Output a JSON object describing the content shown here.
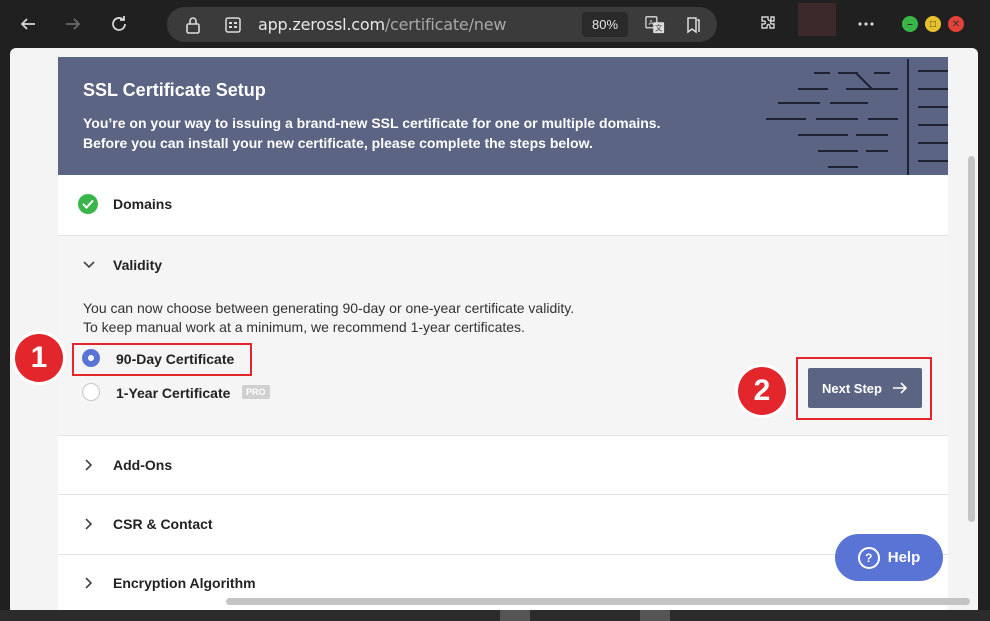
{
  "browser": {
    "url_host": "app.zerossl.com",
    "url_path": "/certificate/new",
    "zoom": "80%"
  },
  "hero": {
    "title": "SSL Certificate Setup",
    "desc_line1": "You’re on your way to issuing a brand-new SSL certificate for one or multiple domains.",
    "desc_line2": "Before you can install your new certificate, please complete the steps below."
  },
  "steps": {
    "domains": "Domains",
    "validity": "Validity",
    "addons": "Add-Ons",
    "csr": "CSR & Contact",
    "encryption": "Encryption Algorithm"
  },
  "validity": {
    "desc_line1": "You can now choose between generating 90-day or one-year certificate validity.",
    "desc_line2": "To keep manual work at a minimum, we recommend 1-year certificates.",
    "option_90": "90-Day Certificate",
    "option_1y": "1-Year Certificate",
    "pro_badge": "PRO",
    "next_label": "Next Step",
    "selected": "90-Day Certificate"
  },
  "annotations": {
    "badge1": "1",
    "badge2": "2"
  },
  "help": {
    "label": "Help"
  },
  "colors": {
    "hero_bg": "#5b6483",
    "accent": "#5a74d6",
    "annotation": "#e3262b",
    "success": "#3ab54a"
  }
}
